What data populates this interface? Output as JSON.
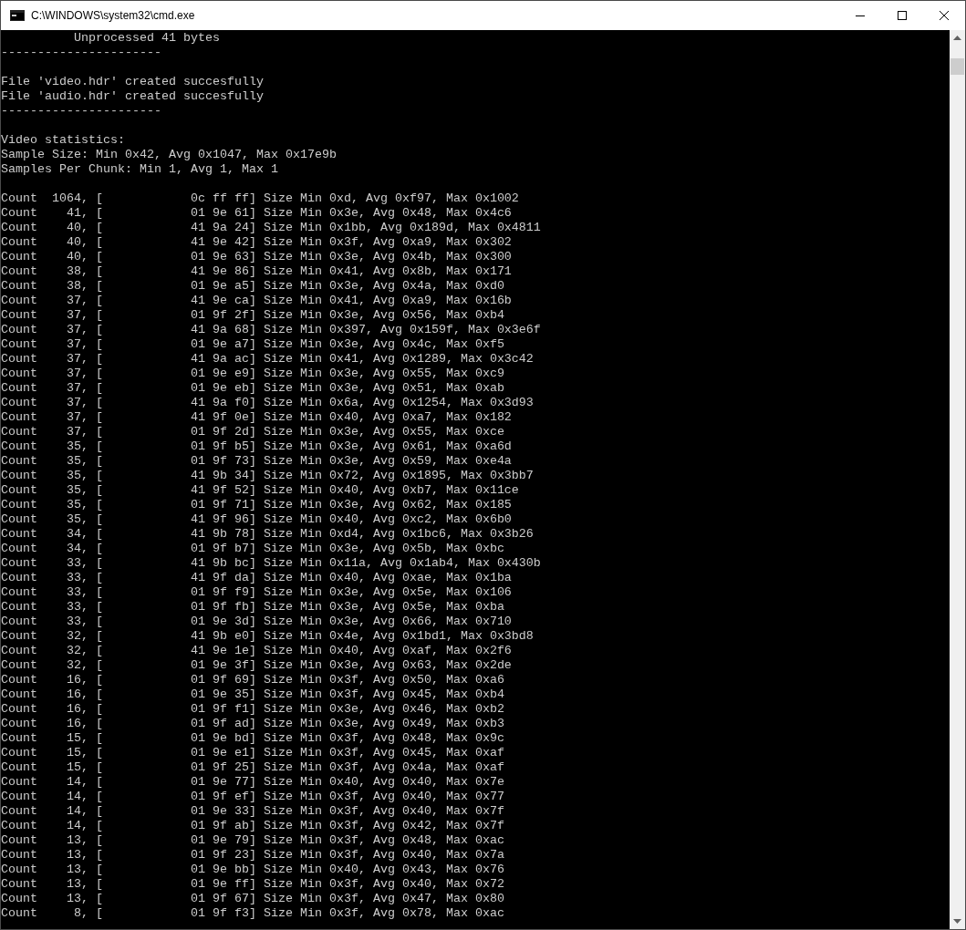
{
  "window": {
    "title": "C:\\WINDOWS\\system32\\cmd.exe"
  },
  "console": {
    "blocks": [
      [
        "          Unprocessed 41 bytes",
        "----------------------"
      ],
      [
        "File 'video.hdr' created succesfully",
        "File 'audio.hdr' created succesfully",
        "----------------------"
      ],
      [
        "Video statistics:",
        "Sample Size: Min 0x42, Avg 0x1047, Max 0x17e9b",
        "Samples Per Chunk: Min 1, Avg 1, Max 1"
      ],
      [
        "Count  1064, [            0c ff ff] Size Min 0xd, Avg 0xf97, Max 0x1002",
        "Count    41, [            01 9e 61] Size Min 0x3e, Avg 0x48, Max 0x4c6",
        "Count    40, [            41 9a 24] Size Min 0x1bb, Avg 0x189d, Max 0x4811",
        "Count    40, [            41 9e 42] Size Min 0x3f, Avg 0xa9, Max 0x302",
        "Count    40, [            01 9e 63] Size Min 0x3e, Avg 0x4b, Max 0x300",
        "Count    38, [            41 9e 86] Size Min 0x41, Avg 0x8b, Max 0x171",
        "Count    38, [            01 9e a5] Size Min 0x3e, Avg 0x4a, Max 0xd0",
        "Count    37, [            41 9e ca] Size Min 0x41, Avg 0xa9, Max 0x16b",
        "Count    37, [            01 9f 2f] Size Min 0x3e, Avg 0x56, Max 0xb4",
        "Count    37, [            41 9a 68] Size Min 0x397, Avg 0x159f, Max 0x3e6f",
        "Count    37, [            01 9e a7] Size Min 0x3e, Avg 0x4c, Max 0xf5",
        "Count    37, [            41 9a ac] Size Min 0x41, Avg 0x1289, Max 0x3c42",
        "Count    37, [            01 9e e9] Size Min 0x3e, Avg 0x55, Max 0xc9",
        "Count    37, [            01 9e eb] Size Min 0x3e, Avg 0x51, Max 0xab",
        "Count    37, [            41 9a f0] Size Min 0x6a, Avg 0x1254, Max 0x3d93",
        "Count    37, [            41 9f 0e] Size Min 0x40, Avg 0xa7, Max 0x182",
        "Count    37, [            01 9f 2d] Size Min 0x3e, Avg 0x55, Max 0xce",
        "Count    35, [            01 9f b5] Size Min 0x3e, Avg 0x61, Max 0xa6d",
        "Count    35, [            01 9f 73] Size Min 0x3e, Avg 0x59, Max 0xe4a",
        "Count    35, [            41 9b 34] Size Min 0x72, Avg 0x1895, Max 0x3bb7",
        "Count    35, [            41 9f 52] Size Min 0x40, Avg 0xb7, Max 0x11ce",
        "Count    35, [            01 9f 71] Size Min 0x3e, Avg 0x62, Max 0x185",
        "Count    35, [            41 9f 96] Size Min 0x40, Avg 0xc2, Max 0x6b0",
        "Count    34, [            41 9b 78] Size Min 0xd4, Avg 0x1bc6, Max 0x3b26",
        "Count    34, [            01 9f b7] Size Min 0x3e, Avg 0x5b, Max 0xbc",
        "Count    33, [            41 9b bc] Size Min 0x11a, Avg 0x1ab4, Max 0x430b",
        "Count    33, [            41 9f da] Size Min 0x40, Avg 0xae, Max 0x1ba",
        "Count    33, [            01 9f f9] Size Min 0x3e, Avg 0x5e, Max 0x106",
        "Count    33, [            01 9f fb] Size Min 0x3e, Avg 0x5e, Max 0xba",
        "Count    33, [            01 9e 3d] Size Min 0x3e, Avg 0x66, Max 0x710",
        "Count    32, [            41 9b e0] Size Min 0x4e, Avg 0x1bd1, Max 0x3bd8",
        "Count    32, [            41 9e 1e] Size Min 0x40, Avg 0xaf, Max 0x2f6",
        "Count    32, [            01 9e 3f] Size Min 0x3e, Avg 0x63, Max 0x2de",
        "Count    16, [            01 9f 69] Size Min 0x3f, Avg 0x50, Max 0xa6",
        "Count    16, [            01 9e 35] Size Min 0x3f, Avg 0x45, Max 0xb4",
        "Count    16, [            01 9f f1] Size Min 0x3e, Avg 0x46, Max 0xb2",
        "Count    16, [            01 9f ad] Size Min 0x3e, Avg 0x49, Max 0xb3",
        "Count    15, [            01 9e bd] Size Min 0x3f, Avg 0x48, Max 0x9c",
        "Count    15, [            01 9e e1] Size Min 0x3f, Avg 0x45, Max 0xaf",
        "Count    15, [            01 9f 25] Size Min 0x3f, Avg 0x4a, Max 0xaf",
        "Count    14, [            01 9e 77] Size Min 0x40, Avg 0x40, Max 0x7e",
        "Count    14, [            01 9f ef] Size Min 0x3f, Avg 0x40, Max 0x77",
        "Count    14, [            01 9e 33] Size Min 0x3f, Avg 0x40, Max 0x7f",
        "Count    14, [            01 9f ab] Size Min 0x3f, Avg 0x42, Max 0x7f",
        "Count    13, [            01 9e 79] Size Min 0x3f, Avg 0x48, Max 0xac",
        "Count    13, [            01 9f 23] Size Min 0x3f, Avg 0x40, Max 0x7a",
        "Count    13, [            01 9e bb] Size Min 0x40, Avg 0x43, Max 0x76",
        "Count    13, [            01 9e ff] Size Min 0x3f, Avg 0x40, Max 0x72",
        "Count    13, [            01 9f 67] Size Min 0x3f, Avg 0x47, Max 0x80",
        "Count     8, [            01 9f f3] Size Min 0x3f, Avg 0x78, Max 0xac"
      ]
    ]
  }
}
